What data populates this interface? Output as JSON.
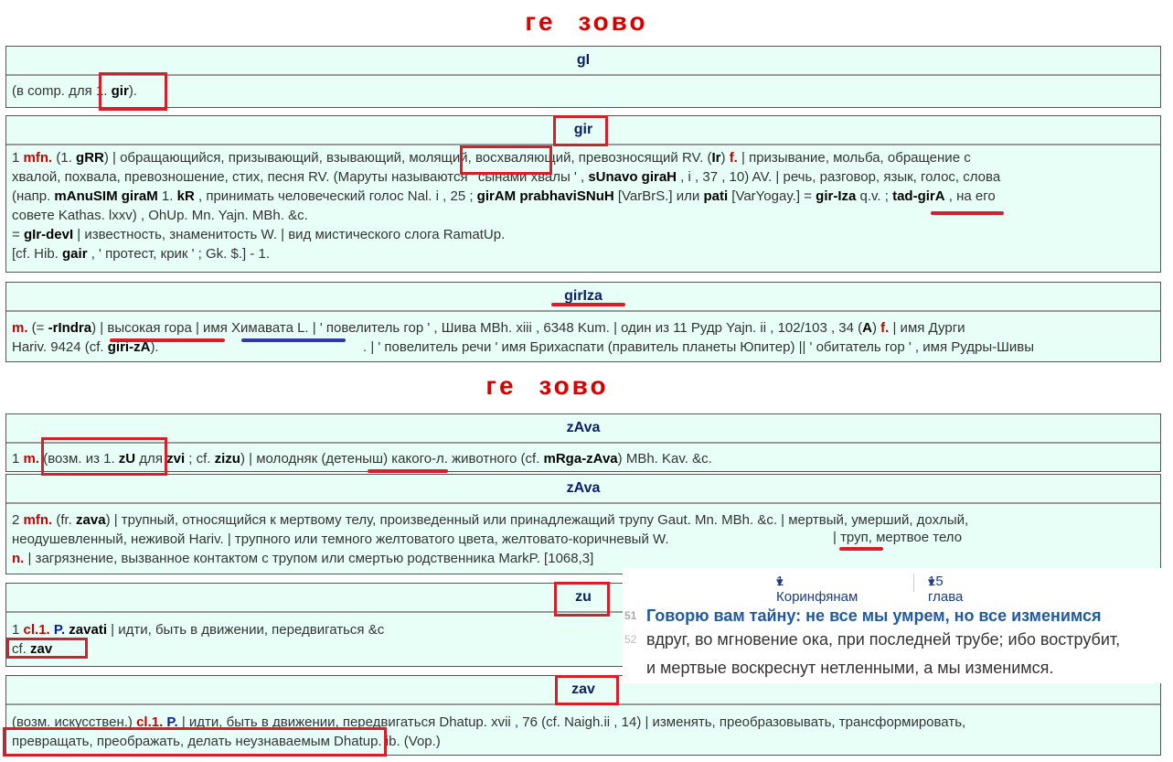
{
  "headings": {
    "top": "ге зово",
    "middle": "ге зово"
  },
  "entries": {
    "gI": {
      "head": "gI",
      "body": {
        "t1": "(в comp. для ",
        "t2": "1. ",
        "t3": "gir",
        "t4": ")."
      }
    },
    "gir": {
      "head": "gir",
      "line1": [
        "1 ",
        "mfn.",
        " (1. ",
        "gRR",
        ") | обращающийся, призывающий, взывающий, ",
        "молящий",
        ", восхваляющий, превозносящий RV. (",
        "Ir",
        ") ",
        "f.",
        " | призывание, мольба, обращение с"
      ],
      "line2": "хвалой, похвала, превозношение, стих, песня RV. (Маруты называются ' сынами хвалы ' , ",
      "line2b": "sUnavo giraH",
      "line2c": " , i , 37 , 10) AV. | речь, разговор, язык, голос, слова",
      "line3": [
        "(напр. ",
        "mAnuSIM giraM",
        " 1. ",
        "kR",
        " , принимать человеческий голос Nal. i , 25 ; ",
        "girAM prabhaviSNuH",
        " [VarBrS.] или ",
        "pati",
        " [VarYogay.] = ",
        "gir-Iza",
        " q.v. ; ",
        "tad-girA",
        " , на его"
      ],
      "line4": "совете Kathas. lxxv) , OhUp. Mn. Yajn. MBh. &c.",
      "line5": [
        "= ",
        "gIr-devI",
        " | известность, знаменитость W. | вид мистического слога RamatUp."
      ],
      "line6": [
        "[cf. Hib. ",
        "gair",
        " , ' протест, крик ' ; Gk. $.] - 1."
      ]
    },
    "girIza": {
      "head": "girIza",
      "line1": [
        "m.",
        " (= ",
        "-rIndra",
        ") | высокая гора | имя Химавата L. | ' повелитель гор ' , Шива MBh. xiii , 6348 Kum. | один из 11 Рудр Yajn. ii , 102/103 , 34 (",
        "A",
        ") ",
        "f.",
        " | имя Дурги"
      ],
      "line2a": "Hariv. 9424 (cf. ",
      "line2b": "giri-zA",
      "line2c": ").",
      "line2d": ". | ' повелитель речи ' имя Брихаспати (правитель планеты Юпитер) || ' обитатель гор ' , имя Рудры-Шивы"
    },
    "zAva1": {
      "head": "zAva",
      "body": [
        "1 ",
        "m.",
        " (возм. из 1. ",
        "zU",
        " для ",
        "zvi",
        " ; cf. ",
        "zizu",
        ") | молодняк (детеныш) какого-л. животного (cf. ",
        "mRga-zAva",
        ") MBh. Kav. &c."
      ]
    },
    "zAva2": {
      "head": "zAva",
      "line1": [
        "2 ",
        "mfn.",
        " (fr. ",
        "zava",
        ") | трупный, относящийся к мертвому телу, произведенный или принадлежащий трупу Gaut. Mn. MBh. &c. | мертвый, умерший, дохлый,"
      ],
      "line2a": "неодушевленный, неживой Hariv. | трупного или темного желтоватого цвета, желтовато-коричневый W.",
      "line2b": "| труп, мертвое тело",
      "line3": [
        "n.",
        " | загрязнение, вызванное контактом с трупом или смертью родственника MarkP. [1068,3]"
      ]
    },
    "zu": {
      "head": "zu",
      "line1": [
        "1 ",
        "cl.1.",
        " ",
        "P.",
        " ",
        "zavati",
        " | идти, быть в движении, передвигаться &c"
      ],
      "line2": [
        "cf. ",
        "zav"
      ]
    },
    "zav": {
      "head": "zav",
      "line1": [
        "(возм. искусствен.) ",
        "cl.1.",
        " ",
        "P.",
        " | идти, быть в движении, передвигаться Dhatup. xvii , 76 (cf. Naigh.ii , 14) | изменять, преобразовывать, трансформировать,"
      ],
      "line2": "превращать, преображать, делать неузнаваемым Dhatup. ib. (Vop.)"
    }
  },
  "bible": {
    "book": "1 Коринфянам",
    "chapter": "15 глава",
    "verses": [
      {
        "num": "51",
        "text": "Говорю вам тайну: не все мы умрем, но все изменимся"
      },
      {
        "num": "52",
        "text": "вдруг, во мгновение ока, при последней трубе; ибо вострубит,"
      },
      {
        "num": "",
        "text": "и мертвые  воскреснут нетленными, а мы изменимся."
      }
    ]
  },
  "colors": {
    "heading": "#d90000",
    "entry_bg": "#e8fff8",
    "headword": "#0a1f66",
    "highlight_box": "#d91e2a",
    "blue_underline": "#2f3aa8",
    "verse_highlight": "#1f5aa6"
  }
}
